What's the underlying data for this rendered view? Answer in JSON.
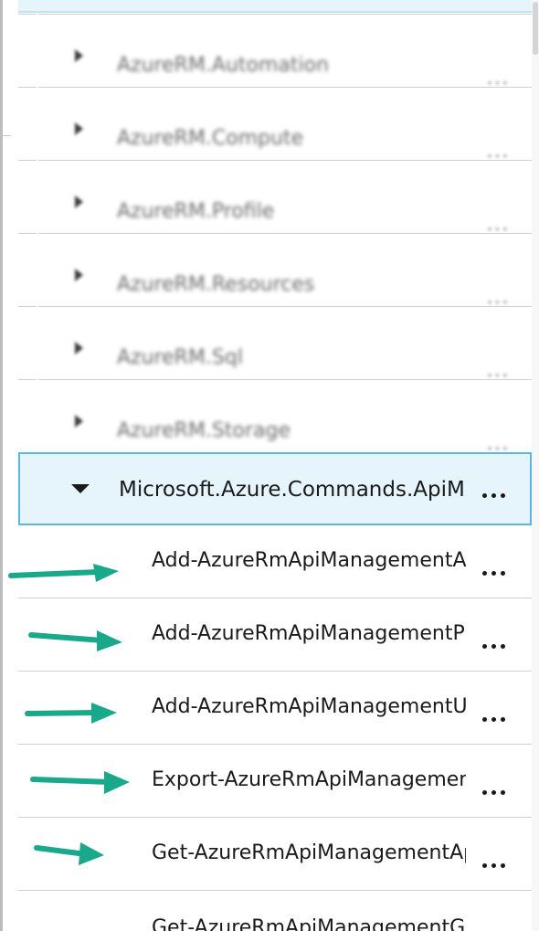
{
  "module_list": {
    "items": [
      {
        "label": "AzureRM.Automation",
        "more": "..."
      },
      {
        "label": "AzureRM.Compute",
        "more": "..."
      },
      {
        "label": "AzureRM.Profile",
        "more": "..."
      },
      {
        "label": "AzureRM.Resources",
        "more": "..."
      },
      {
        "label": "AzureRM.Sql",
        "more": "..."
      },
      {
        "label": "AzureRM.Storage",
        "more": "..."
      }
    ],
    "expanded": {
      "label": "Microsoft.Azure.Commands.ApiManagement",
      "more": "..."
    }
  },
  "commands": {
    "items": [
      {
        "label": "Add-AzureRmApiManagementApiToProduct",
        "more": "..."
      },
      {
        "label": "Add-AzureRmApiManagementProductToGroup",
        "more": "..."
      },
      {
        "label": "Add-AzureRmApiManagementUserToGroup",
        "more": "..."
      },
      {
        "label": "Export-AzureRmApiManagementApi",
        "more": "..."
      },
      {
        "label": "Get-AzureRmApiManagementApi",
        "more": "..."
      },
      {
        "label": "Get-AzureRmApiManagementGroup",
        "more": "..."
      }
    ]
  },
  "annotations": {
    "arrow_color": "#1aa88a"
  },
  "icons": {
    "collapsed": "caret-right-icon",
    "expanded": "caret-down-icon",
    "more": "ellipsis-icon",
    "annotation": "arrow-right-icon"
  }
}
